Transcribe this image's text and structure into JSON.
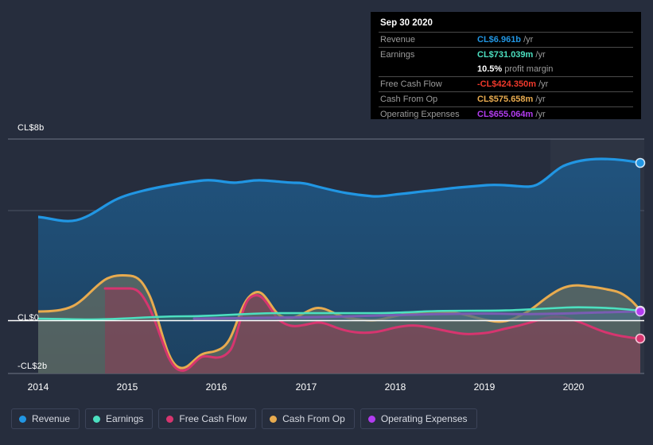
{
  "tooltip": {
    "date": "Sep 30 2020",
    "rows": [
      {
        "key": "Revenue",
        "value": "CL$6.961b",
        "unit": "/yr",
        "color": "#2196e3",
        "rule": true
      },
      {
        "key": "Earnings",
        "value": "CL$731.039m",
        "unit": "/yr",
        "color": "#4ce0c0",
        "rule": true
      },
      {
        "key": "",
        "value": "10.5%",
        "unit": "profit margin",
        "color": "#ffffff",
        "rule": false
      },
      {
        "key": "Free Cash Flow",
        "value": "-CL$424.350m",
        "unit": "/yr",
        "color": "#f0392b",
        "rule": true
      },
      {
        "key": "Cash From Op",
        "value": "CL$575.658m",
        "unit": "/yr",
        "color": "#e8ab4f",
        "rule": true
      },
      {
        "key": "Operating Expenses",
        "value": "CL$655.064m",
        "unit": "/yr",
        "color": "#b23cf0",
        "rule": true
      }
    ]
  },
  "legend": {
    "items": [
      {
        "label": "Revenue",
        "color": "#2196e3"
      },
      {
        "label": "Earnings",
        "color": "#4ce0c0"
      },
      {
        "label": "Free Cash Flow",
        "color": "#d6356f"
      },
      {
        "label": "Cash From Op",
        "color": "#e8ab4f"
      },
      {
        "label": "Operating Expenses",
        "color": "#b23cf0"
      }
    ]
  },
  "chart_data": {
    "type": "area",
    "title": "",
    "xlabel": "",
    "ylabel": "",
    "currency": "CL$",
    "grid": true,
    "legend_position": "bottom",
    "ylim": [
      -2,
      8
    ],
    "y_ticks": [
      {
        "label": "CL$8b",
        "value": 8
      },
      {
        "label": "CL$0",
        "value": 0
      },
      {
        "label": "-CL$2b",
        "value": -2
      }
    ],
    "x_ticks": [
      "2014",
      "2015",
      "2016",
      "2017",
      "2018",
      "2019",
      "2020"
    ],
    "x_range": [
      "2013-09",
      "2020-09"
    ],
    "zero_line": 0,
    "highlight_band": {
      "from": "2020-01",
      "to": "2020-09"
    },
    "series": [
      {
        "name": "Revenue",
        "color": "#2196e3",
        "fill": "#1d4768",
        "units": "CL$b",
        "x": [
          2013.75,
          2014.0,
          2014.25,
          2014.5,
          2014.75,
          2015.0,
          2015.25,
          2015.5,
          2015.75,
          2016.0,
          2016.25,
          2016.5,
          2016.75,
          2017.0,
          2017.25,
          2017.5,
          2017.75,
          2018.0,
          2018.25,
          2018.5,
          2018.75,
          2019.0,
          2019.25,
          2019.5,
          2019.75,
          2020.0,
          2020.25,
          2020.5,
          2020.75
        ],
        "values": [
          4.0,
          3.95,
          4.2,
          4.55,
          4.9,
          5.25,
          5.5,
          5.7,
          5.9,
          6.1,
          6.05,
          6.15,
          6.1,
          6.0,
          6.05,
          6.0,
          5.85,
          5.7,
          5.65,
          5.7,
          5.75,
          5.9,
          6.05,
          6.15,
          6.05,
          6.25,
          6.75,
          6.95,
          6.961
        ]
      },
      {
        "name": "Earnings",
        "color": "#4ce0c0",
        "fill": "#2f6a60",
        "units": "CL$m",
        "x": [
          2013.75,
          2014.0,
          2014.25,
          2014.5,
          2014.75,
          2015.0,
          2015.25,
          2015.5,
          2015.75,
          2016.0,
          2016.25,
          2016.5,
          2016.75,
          2017.0,
          2017.25,
          2017.5,
          2017.75,
          2018.0,
          2018.25,
          2018.5,
          2018.75,
          2019.0,
          2019.25,
          2019.5,
          2019.75,
          2020.0,
          2020.25,
          2020.5,
          2020.75
        ],
        "values": [
          0.05,
          0.05,
          0.045,
          0.04,
          0.04,
          0.05,
          0.08,
          0.11,
          0.13,
          0.15,
          0.16,
          0.15,
          0.14,
          0.15,
          0.16,
          0.17,
          0.18,
          0.19,
          0.2,
          0.23,
          0.27,
          0.3,
          0.29,
          0.28,
          0.3,
          0.36,
          0.42,
          0.46,
          0.731
        ]
      },
      {
        "name": "Free Cash Flow",
        "color": "#d6356f",
        "fill": "#7a3046",
        "units": "CL$m",
        "x": [
          2013.75,
          2014.0,
          2014.25,
          2014.5,
          2014.75,
          2015.0,
          2015.25,
          2015.5,
          2015.75,
          2016.0,
          2016.25,
          2016.5,
          2016.75,
          2017.0,
          2017.25,
          2017.5,
          2017.75,
          2018.0,
          2018.25,
          2018.5,
          2018.75,
          2019.0,
          2019.25,
          2019.5,
          2019.75,
          2020.0,
          2020.25,
          2020.5,
          2020.75
        ],
        "values": [
          0.64,
          0.64,
          0.64,
          0.64,
          0.64,
          0.64,
          0.1,
          -1.72,
          -1.3,
          -1.45,
          -1.1,
          0.62,
          0.03,
          -0.16,
          -0.15,
          0.08,
          -0.09,
          -0.33,
          -0.36,
          -0.3,
          -0.15,
          -0.07,
          -0.23,
          -0.3,
          -0.06,
          0.06,
          -0.1,
          0.06,
          -0.424
        ]
      },
      {
        "name": "Cash From Op",
        "color": "#e8ab4f",
        "fill": "#6b6a56",
        "units": "CL$m",
        "x": [
          2013.75,
          2014.0,
          2014.25,
          2014.5,
          2014.75,
          2015.0,
          2015.25,
          2015.5,
          2015.75,
          2016.0,
          2016.25,
          2016.5,
          2016.75,
          2017.0,
          2017.25,
          2017.5,
          2017.75,
          2018.0,
          2018.25,
          2018.5,
          2018.75,
          2019.0,
          2019.25,
          2019.5,
          2019.75,
          2020.0,
          2020.25,
          2020.5,
          2020.75
        ],
        "values": [
          0.42,
          0.42,
          0.43,
          0.7,
          0.95,
          0.96,
          0.95,
          -1.47,
          -1.05,
          -1.2,
          -0.82,
          0.88,
          0.27,
          0.11,
          0.32,
          0.23,
          0.07,
          0.02,
          0.03,
          0.11,
          0.2,
          0.23,
          0.1,
          -0.06,
          0.18,
          0.6,
          0.78,
          0.72,
          0.576
        ]
      },
      {
        "name": "Operating Expenses",
        "color": "#b23cf0",
        "fill": "#4b4093",
        "units": "CL$m",
        "x": [
          2015.75,
          2016.0,
          2016.25,
          2016.5,
          2016.75,
          2017.0,
          2017.25,
          2017.5,
          2017.75,
          2018.0,
          2018.25,
          2018.5,
          2018.75,
          2019.0,
          2019.25,
          2019.5,
          2019.75,
          2020.0,
          2020.25,
          2020.5,
          2020.75
        ],
        "values": [
          0.04,
          0.04,
          0.045,
          0.05,
          0.06,
          0.07,
          0.075,
          0.08,
          0.09,
          0.095,
          0.1,
          0.105,
          0.11,
          0.12,
          0.13,
          0.14,
          0.15,
          0.16,
          0.17,
          0.175,
          0.655
        ]
      }
    ]
  }
}
